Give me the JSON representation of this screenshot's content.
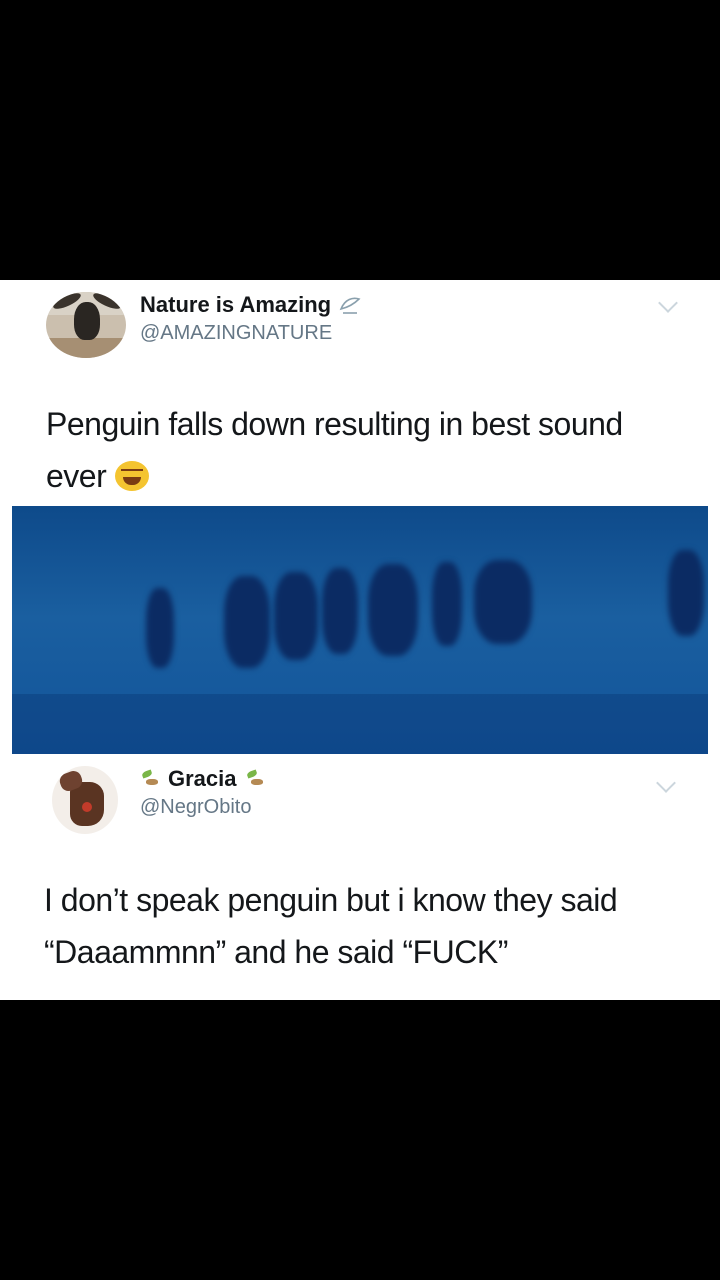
{
  "tweet": {
    "display_name": "Nature is Amazing",
    "handle": "@AMAZINGNATURE",
    "text_line1": "Penguin falls down resulting in best sound",
    "text_line2": "ever",
    "emoji_icon": "laughing-face-icon",
    "badge_icon": "leaf-icon"
  },
  "reply": {
    "display_name": "Gracia",
    "handle": "@NegrObito",
    "text_line1": "I don’t speak penguin but i know they said",
    "text_line2": "“Daaammnn” and he said “FUCK”",
    "badge_icon": "sprout-icon"
  },
  "colors": {
    "name": "#14171a",
    "handle": "#657786",
    "media_water": "#12508f",
    "penguins": "#0b2b63"
  }
}
